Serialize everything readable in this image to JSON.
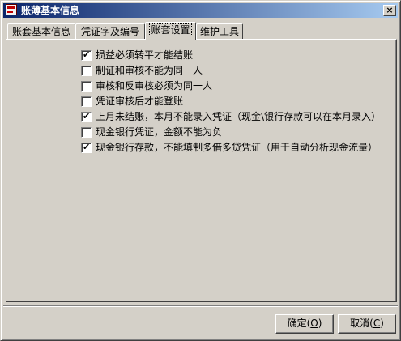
{
  "window": {
    "title": "账薄基本信息",
    "close_glyph": "×"
  },
  "tabs": [
    {
      "label": "账套基本信息"
    },
    {
      "label": "凭证字及编号"
    },
    {
      "label": "账套设置"
    },
    {
      "label": "维护工具"
    }
  ],
  "active_tab": 2,
  "options": [
    {
      "label": "损益必须转平才能结账",
      "checked": true
    },
    {
      "label": "制证和审核不能为同一人",
      "checked": false
    },
    {
      "label": "审核和反审核必须为同一人",
      "checked": false
    },
    {
      "label": "凭证审核后才能登账",
      "checked": false
    },
    {
      "label": "上月未结账，本月不能录入凭证（现金\\银行存款可以在本月录入）",
      "checked": true
    },
    {
      "label": "现金银行凭证，金额不能为负",
      "checked": false
    },
    {
      "label": "现金银行存款，不能填制多借多贷凭证（用于自动分析现金流量）",
      "checked": true
    }
  ],
  "checkmark_glyph": "✔",
  "buttons": {
    "ok": {
      "label": "确定",
      "mnemonic": "O"
    },
    "cancel": {
      "label": "取消",
      "mnemonic": "C"
    }
  }
}
